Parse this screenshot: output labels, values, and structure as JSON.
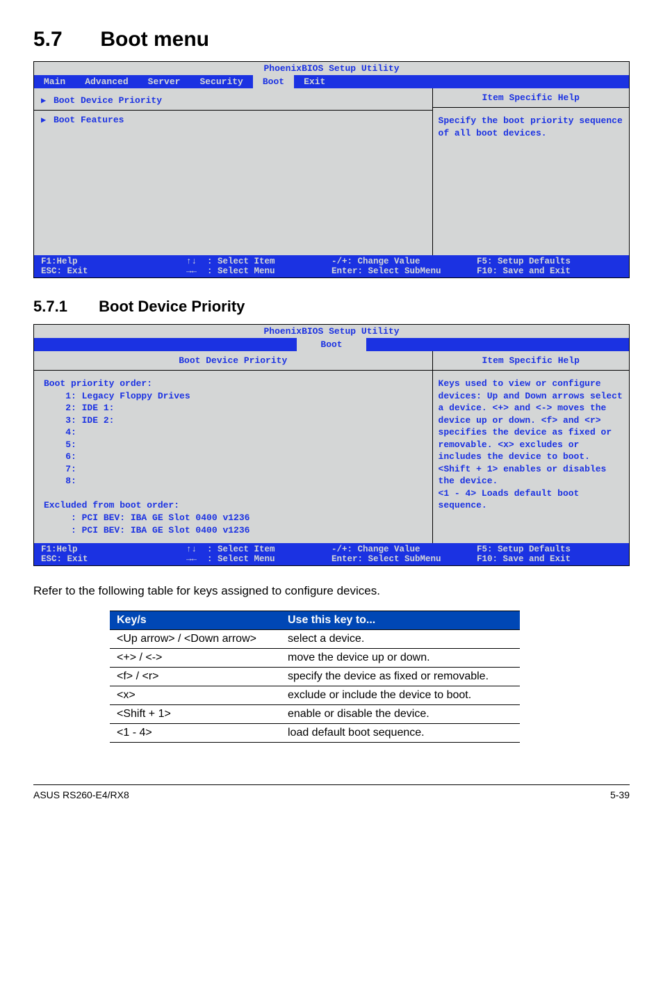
{
  "section": {
    "num": "5.7",
    "title": "Boot menu"
  },
  "subsection": {
    "num": "5.7.1",
    "title": "Boot Device Priority"
  },
  "bios1": {
    "title": "PhoenixBIOS Setup Utility",
    "tabs": {
      "main": "Main",
      "advanced": "Advanced",
      "server": "Server",
      "security": "Security",
      "boot": "Boot",
      "exit": "Exit"
    },
    "row1": "Boot Device Priority",
    "row2": "Boot Features",
    "help_header": "Item Specific Help",
    "help_body": "Specify the boot priority sequence of all boot devices.",
    "footer": {
      "c1": "F1:Help\nESC: Exit",
      "c2": "↑↓  : Select Item\n→←  : Select Menu",
      "c3": "-/+: Change Value\nEnter: Select SubMenu",
      "c4": "F5: Setup Defaults\nF10: Save and Exit"
    }
  },
  "bios2": {
    "title": "PhoenixBIOS Setup Utility",
    "tab": "Boot",
    "subhead": "Boot Device Priority",
    "help_header": "Item Specific Help",
    "content": "Boot priority order:\n    1: Legacy Floppy Drives\n    2: IDE 1:\n    3: IDE 2:\n    4:\n    5:\n    6:\n    7:\n    8:\n\nExcluded from boot order:\n     : PCI BEV: IBA GE Slot 0400 v1236\n     : PCI BEV: IBA GE Slot 0400 v1236",
    "help_body": "Keys used to view or configure devices: Up and Down arrows select a device. <+> and <-> moves the device up or down. <f> and <r> specifies the device as fixed or removable. <x> excludes or includes the device to boot.\n<Shift + 1> enables or disables the device.\n<1 - 4> Loads default boot sequence.",
    "footer": {
      "c1": "F1:Help\nESC: Exit",
      "c2": "↑↓  : Select Item\n→←  : Select Menu",
      "c3": "-/+: Change Value\nEnter: Select SubMenu",
      "c4": "F5: Setup Defaults\nF10: Save and Exit"
    }
  },
  "intro_text": "Refer to the following table for keys assigned to configure devices.",
  "keytable": {
    "headers": {
      "keys": "Key/s",
      "use": "Use this key to..."
    },
    "rows": [
      {
        "k": "<Up arrow> / <Down arrow>",
        "u": "select a device."
      },
      {
        "k": "<+> / <->",
        "u": "move the device up or down."
      },
      {
        "k": "<f> / <r>",
        "u": "specify the device as fixed or removable."
      },
      {
        "k": "<x>",
        "u": "exclude or include the device to boot."
      },
      {
        "k": "<Shift + 1>",
        "u": "enable or disable the device."
      },
      {
        "k": "<1 - 4>",
        "u": "load default boot sequence."
      }
    ]
  },
  "footer": {
    "left": "ASUS RS260-E4/RX8",
    "right": "5-39"
  }
}
